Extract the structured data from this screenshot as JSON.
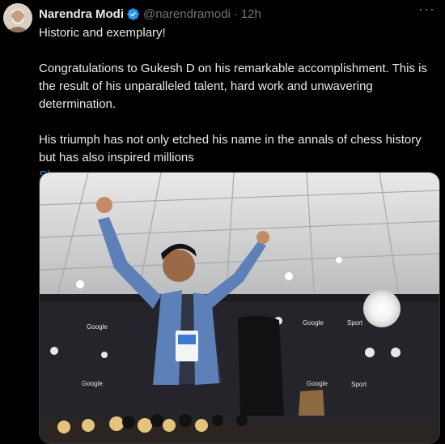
{
  "tweet": {
    "author_name": "Narendra Modi",
    "handle": "@narendramodi",
    "separator": "·",
    "time": "12h",
    "more_label": "···",
    "paragraphs": [
      "Historic and exemplary!",
      "Congratulations to Gukesh D on his remarkable accomplishment. This is the result of his unparalleled talent, hard work and unwavering determination.",
      "His triumph has not only etched his name in the annals of chess history but has also inspired millions"
    ],
    "show_more": "Show more"
  },
  "media": {
    "backdrop_logos": [
      "Google",
      "Google",
      "Google",
      "Google",
      "Sport"
    ]
  },
  "colors": {
    "background": "#000000",
    "text": "#e7e9ea",
    "muted": "#71767b",
    "link": "#1d9bf0",
    "verified": "#1d9bf0"
  },
  "icons": [
    "verified-badge-icon",
    "more-options-icon"
  ]
}
